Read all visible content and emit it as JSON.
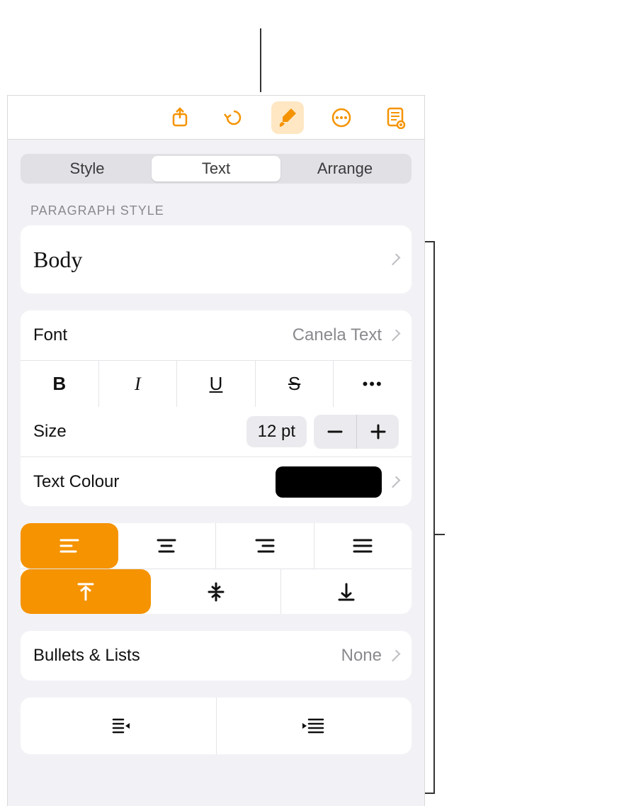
{
  "toolbar": {
    "share_icon": "share-icon",
    "undo_icon": "undo-icon",
    "format_icon": "paintbrush-icon",
    "more_icon": "more-icon",
    "document_icon": "document-view-icon"
  },
  "tabs": {
    "style": "Style",
    "text": "Text",
    "arrange": "Arrange"
  },
  "paragraph_style": {
    "section_label": "PARAGRAPH STYLE",
    "name": "Body"
  },
  "font": {
    "label": "Font",
    "value": "Canela Text",
    "bold_glyph": "B",
    "italic_glyph": "I",
    "underline_glyph": "U",
    "strike_glyph": "S",
    "more_glyph": "•••"
  },
  "size": {
    "label": "Size",
    "value": "12 pt"
  },
  "text_colour": {
    "label": "Text Colour",
    "swatch_hex": "#000000"
  },
  "alignment": {
    "selected_h": "left",
    "selected_v": "top"
  },
  "bullets": {
    "label": "Bullets & Lists",
    "value": "None"
  },
  "colors": {
    "accent": "#f59300",
    "accent_bg": "#ffe7c4"
  }
}
